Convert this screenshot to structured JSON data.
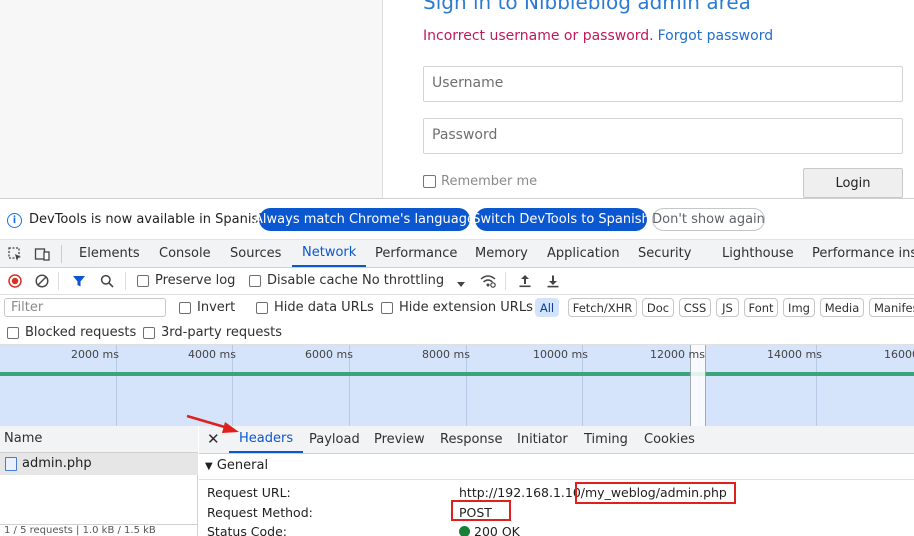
{
  "page": {
    "title": "Sign in to Nibbleblog admin area",
    "error": "Incorrect username or password.",
    "forgot_link": "Forgot password",
    "username_placeholder": "Username",
    "password_placeholder": "Password",
    "remember_label": "Remember me",
    "login_label": "Login"
  },
  "infobar": {
    "text": "DevTools is now available in Spanish!",
    "match_label": "Always match Chrome's language",
    "switch_label": "Switch DevTools to Spanish",
    "dont_show_label": "Don't show again"
  },
  "tabs": [
    "Elements",
    "Console",
    "Sources",
    "Network",
    "Performance",
    "Memory",
    "Application",
    "Security",
    "Lighthouse",
    "Performance insi"
  ],
  "toolbar": {
    "preserve_log": "Preserve log",
    "disable_cache": "Disable cache",
    "throttling": "No throttling"
  },
  "filter": {
    "placeholder": "Filter",
    "invert": "Invert",
    "hide_data_urls": "Hide data URLs",
    "hide_ext_urls": "Hide extension URLs",
    "chips": [
      "All",
      "Fetch/XHR",
      "Doc",
      "CSS",
      "JS",
      "Font",
      "Img",
      "Media",
      "Manifes"
    ]
  },
  "blocked": {
    "blocked_requests": "Blocked requests",
    "third_party": "3rd-party requests"
  },
  "overview": {
    "ticks": [
      "2000 ms",
      "4000 ms",
      "6000 ms",
      "8000 ms",
      "10000 ms",
      "12000 ms",
      "14000 ms",
      "16000"
    ]
  },
  "requests": {
    "header": "Name",
    "rows": [
      "admin.php"
    ],
    "status_bar": "1 / 5 requests | 1.0 kB / 1.5 kB"
  },
  "details": {
    "tabs": [
      "Headers",
      "Payload",
      "Preview",
      "Response",
      "Initiator",
      "Timing",
      "Cookies"
    ],
    "active_tab": "Headers",
    "section": "General",
    "request_url_key": "Request URL:",
    "request_url_value": "http://192.168.1.10/my_weblog/admin.php",
    "request_method_key": "Request Method:",
    "request_method_value": "POST",
    "status_code_key": "Status Code:",
    "status_code_value": "200 OK"
  },
  "colors": {
    "accent": "#0b57d0",
    "error": "#c2185b",
    "annotation": "#e0201c",
    "status_ok": "#188038"
  }
}
